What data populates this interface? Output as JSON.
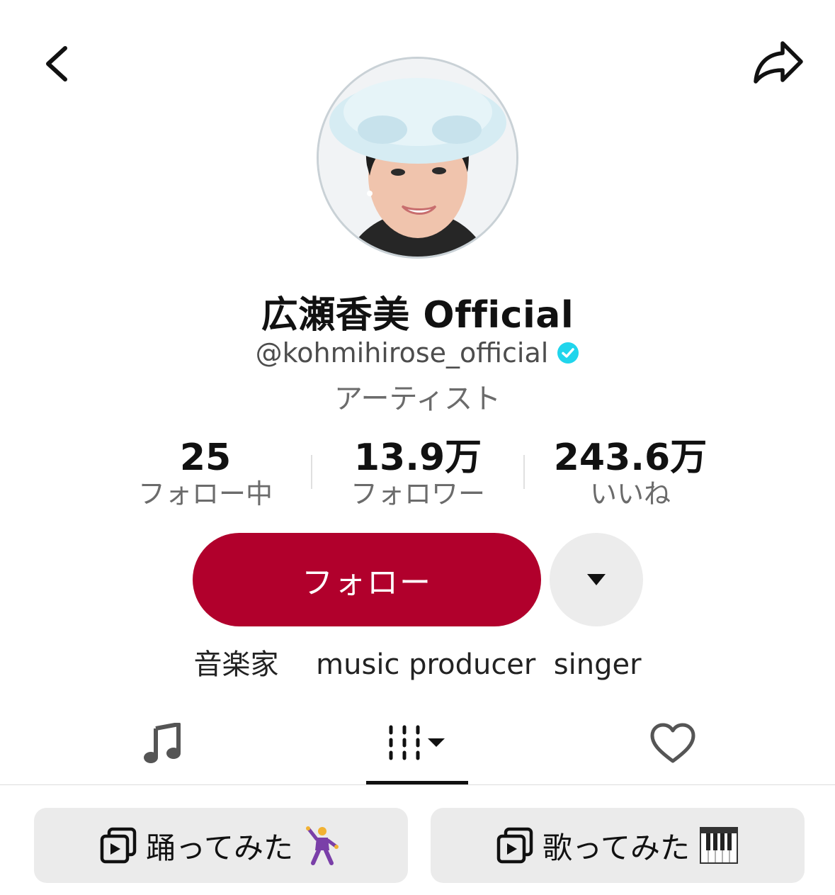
{
  "header": {
    "back_icon": "chevron-left-icon",
    "share_icon": "share-arrow-icon"
  },
  "profile": {
    "avatar": "profile-photo",
    "display_name": "広瀬香美 Official",
    "handle": "@kohmihirose_official",
    "verified_color": "#20d5ec",
    "category": "アーティスト"
  },
  "stats": [
    {
      "value": "25",
      "label": "フォロー中"
    },
    {
      "value": "13.9万",
      "label": "フォロワー"
    },
    {
      "value": "243.6万",
      "label": "いいね"
    }
  ],
  "actions": {
    "follow_label": "フォロー",
    "follow_color": "#b1002c",
    "more_icon": "caret-down-icon"
  },
  "bio": "音楽家　 music producer  singer",
  "tabs": [
    {
      "icon": "music-note-icon"
    },
    {
      "icon": "grid-icon",
      "selected": true
    },
    {
      "icon": "heart-icon"
    }
  ],
  "playlists": [
    {
      "icon": "playlist-icon",
      "label": "踊ってみた",
      "emoji": "dancing-man-emoji"
    },
    {
      "icon": "playlist-icon",
      "label": "歌ってみた",
      "emoji": "piano-keys-emoji"
    }
  ]
}
